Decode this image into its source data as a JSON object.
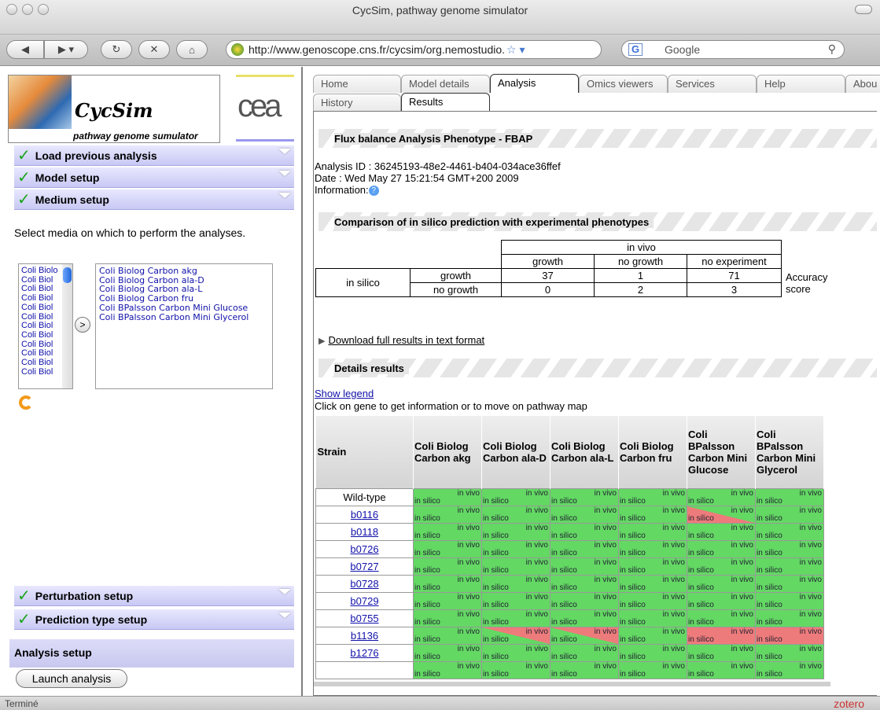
{
  "window": {
    "title": "CycSim, pathway genome simulator"
  },
  "toolbar": {
    "url": "http://www.genoscope.cns.fr/cycsim/org.nemostudio.",
    "search_placeholder": "Google"
  },
  "sidebar": {
    "logo": {
      "title": "CycSim",
      "subtitle": "pathway genome sumulator",
      "partner": "cea"
    },
    "sections": [
      {
        "label": "Load previous analysis"
      },
      {
        "label": "Model setup"
      },
      {
        "label": "Medium setup"
      }
    ],
    "medium_instruction": "Select media on which to perform the analyses.",
    "available_media": [
      "Coli Biolo",
      "Coli Biol",
      "Coli Biol",
      "Coli Biol",
      "Coli Biol",
      "Coli Biol",
      "Coli Biol",
      "Coli Biol",
      "Coli Biol",
      "Coli Biol",
      "Coli Biol",
      "Coli Biol"
    ],
    "move_label": ">",
    "selected_media": [
      "Coli Biolog Carbon akg",
      "Coli Biolog Carbon ala-D",
      "Coli Biolog Carbon ala-L",
      "Coli Biolog Carbon fru",
      "Coli BPalsson Carbon Mini Glucose",
      "Coli BPalsson Carbon Mini Glycerol"
    ],
    "bottom_sections": [
      {
        "label": "Perturbation setup"
      },
      {
        "label": "Prediction type setup"
      }
    ],
    "analysis_setup": "Analysis setup",
    "launch_button": "Launch analysis"
  },
  "tabs": {
    "top": [
      "Home",
      "Model details",
      "Analysis",
      "Omics viewers",
      "Services",
      "Help",
      "Abou"
    ],
    "active_top": "Analysis",
    "sub": [
      "History",
      "Results"
    ],
    "active_sub": "Results"
  },
  "results": {
    "title": "Flux balance Analysis Phenotype - FBAP",
    "analysis_id": "Analysis ID : 36245193-48e2-4461-b404-034ace36ffef",
    "date": "Date : Wed May 27 15:21:54 GMT+200 2009",
    "information": "Information:",
    "comparison_title": "Comparison of in silico prediction with experimental phenotypes",
    "comparison": {
      "in_vivo": "in vivo",
      "in_silico": "in silico",
      "cols": [
        "growth",
        "no growth",
        "no experiment"
      ],
      "rows": [
        {
          "label": "growth",
          "values": [
            "37",
            "1",
            "71"
          ]
        },
        {
          "label": "no growth",
          "values": [
            "0",
            "2",
            "3"
          ]
        }
      ],
      "accuracy_label": "Accuracy score"
    },
    "download": "Download full results in text format",
    "details_title": "Details results",
    "show_legend": "Show legend",
    "click_hint": "Click on gene to get information or to move on pathway map",
    "details": {
      "strain_header": "Strain",
      "media_headers": [
        "Coli Biolog Carbon akg",
        "Coli Biolog Carbon ala-D",
        "Coli Biolog Carbon ala-L",
        "Coli Biolog Carbon fru",
        "Coli BPalsson Carbon Mini Glucose",
        "Coli BPalsson Carbon Mini Glycerol"
      ],
      "cell_top": "in vivo",
      "cell_bottom": "in silico",
      "colors": {
        "green": "#63d863",
        "red": "#ee7b7b",
        "white": "#ffffff"
      },
      "rows": [
        {
          "strain": "Wild-type",
          "cells": [
            "g",
            "g",
            "g",
            "g",
            "g",
            "g"
          ]
        },
        {
          "strain": "b0116",
          "cells": [
            "g",
            "g",
            "g",
            "g",
            "gr",
            "g"
          ]
        },
        {
          "strain": "b0118",
          "cells": [
            "g",
            "g",
            "g",
            "g",
            "g",
            "g"
          ]
        },
        {
          "strain": "b0726",
          "cells": [
            "g",
            "g",
            "g",
            "g",
            "g",
            "g"
          ]
        },
        {
          "strain": "b0727",
          "cells": [
            "g",
            "g",
            "g",
            "g",
            "g",
            "g"
          ]
        },
        {
          "strain": "b0728",
          "cells": [
            "g",
            "g",
            "g",
            "g",
            "g",
            "g"
          ]
        },
        {
          "strain": "b0729",
          "cells": [
            "g",
            "g",
            "g",
            "g",
            "g",
            "g"
          ]
        },
        {
          "strain": "b0755",
          "cells": [
            "g",
            "g",
            "g",
            "g",
            "g",
            "g"
          ]
        },
        {
          "strain": "b1136",
          "cells": [
            "g",
            "rg",
            "rg",
            "g",
            "r",
            "r"
          ]
        },
        {
          "strain": "b1276",
          "cells": [
            "g",
            "g",
            "g",
            "g",
            "g",
            "g"
          ]
        },
        {
          "strain": "",
          "cells": [
            "g",
            "g",
            "g",
            "g",
            "g",
            "g"
          ]
        }
      ]
    }
  },
  "status": {
    "text": "Terminé",
    "zotero": "zotero"
  }
}
